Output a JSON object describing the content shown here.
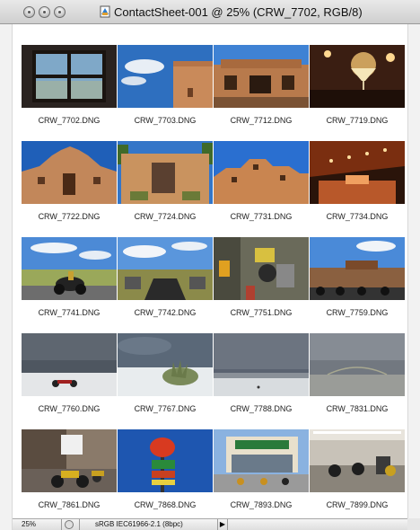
{
  "window": {
    "title": "ContactSheet-001 @ 25% (CRW_7702, RGB/8)"
  },
  "thumbnails": [
    {
      "filename": "CRW_7702.DNG"
    },
    {
      "filename": "CRW_7703.DNG"
    },
    {
      "filename": "CRW_7712.DNG"
    },
    {
      "filename": "CRW_7719.DNG"
    },
    {
      "filename": "CRW_7722.DNG"
    },
    {
      "filename": "CRW_7724.DNG"
    },
    {
      "filename": "CRW_7731.DNG"
    },
    {
      "filename": "CRW_7734.DNG"
    },
    {
      "filename": "CRW_7741.DNG"
    },
    {
      "filename": "CRW_7742.DNG"
    },
    {
      "filename": "CRW_7751.DNG"
    },
    {
      "filename": "CRW_7759.DNG"
    },
    {
      "filename": "CRW_7760.DNG"
    },
    {
      "filename": "CRW_7767.DNG"
    },
    {
      "filename": "CRW_7788.DNG"
    },
    {
      "filename": "CRW_7831.DNG"
    },
    {
      "filename": "CRW_7861.DNG"
    },
    {
      "filename": "CRW_7868.DNG"
    },
    {
      "filename": "CRW_7893.DNG"
    },
    {
      "filename": "CRW_7899.DNG"
    }
  ],
  "statusbar": {
    "zoom": "25%",
    "color_profile": "sRGB IEC61966-2.1 (8bpc)",
    "arrow": "▶"
  }
}
